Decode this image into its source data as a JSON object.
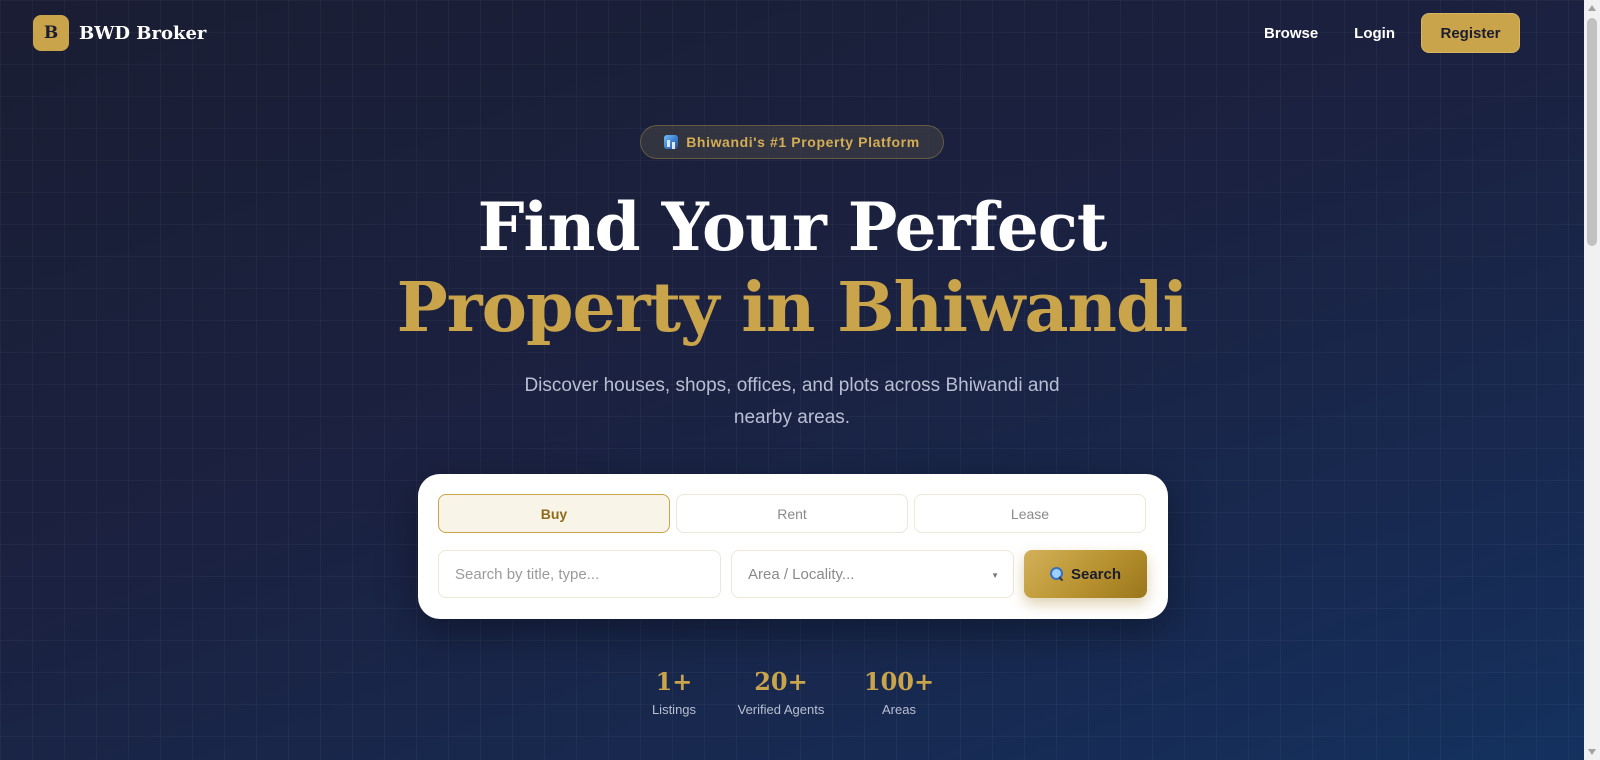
{
  "header": {
    "logo_letter": "B",
    "brand": "BWD Broker",
    "nav": {
      "browse": "Browse",
      "login": "Login",
      "register": "Register"
    }
  },
  "hero": {
    "badge": "Bhiwandi's #1 Property Platform",
    "badge_icon": "city-icon",
    "title_line1": "Find Your Perfect",
    "title_line2": "Property in Bhiwandi",
    "subtitle": "Discover houses, shops, offices, and plots across Bhiwandi and nearby areas."
  },
  "search": {
    "tabs": [
      {
        "label": "Buy",
        "active": true
      },
      {
        "label": "Rent",
        "active": false
      },
      {
        "label": "Lease",
        "active": false
      }
    ],
    "keyword_placeholder": "Search by title, type...",
    "area_placeholder": "Area / Locality...",
    "button_label": "Search",
    "button_icon": "magnifier-icon"
  },
  "stats": [
    {
      "value": "1+",
      "label": "Listings"
    },
    {
      "value": "20+",
      "label": "Verified Agents"
    },
    {
      "value": "100+",
      "label": "Areas"
    }
  ],
  "colors": {
    "accent_gold": "#c9a44b",
    "background_navy": "#1b2140",
    "text_muted": "#b9bfd2"
  }
}
